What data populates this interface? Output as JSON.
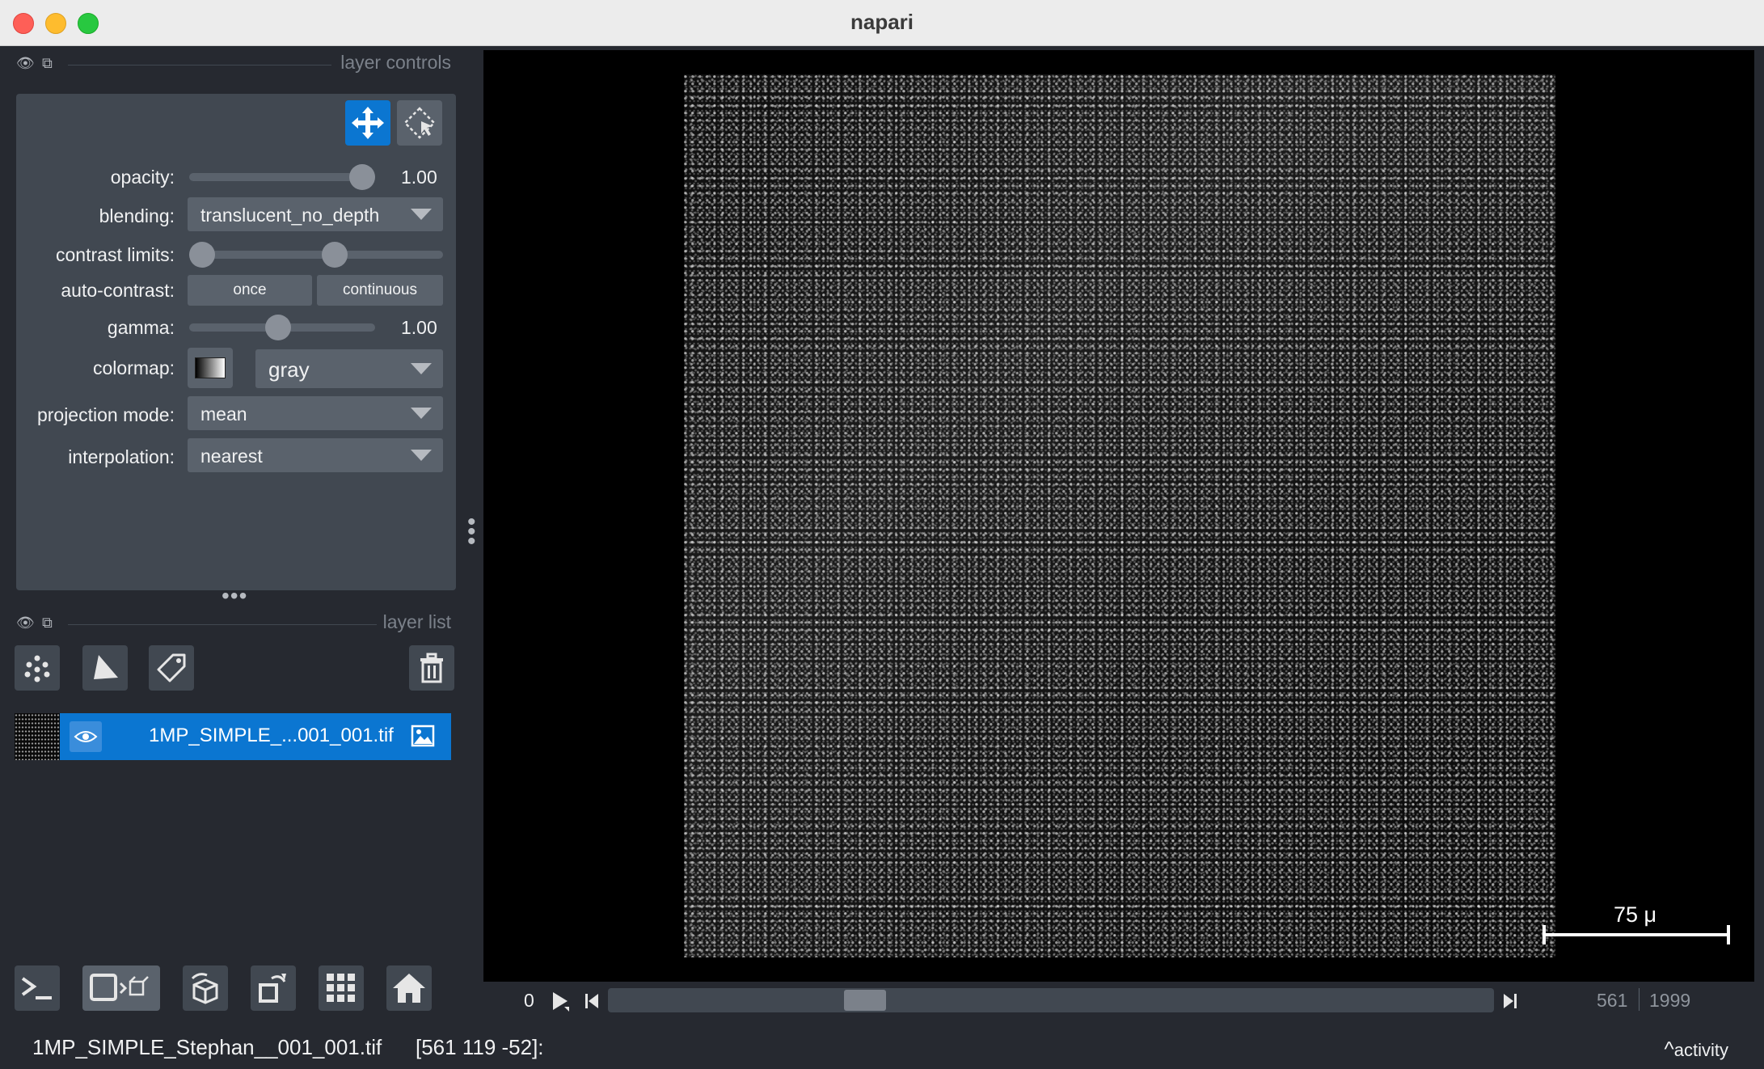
{
  "window": {
    "title": "napari"
  },
  "layer_controls": {
    "dock_label": "layer controls",
    "opacity_label": "opacity:",
    "opacity_value": "1.00",
    "opacity": 1.0,
    "blending_label": "blending:",
    "blending_value": "translucent_no_depth",
    "contrast_label": "contrast limits:",
    "contrast_limits_fraction": [
      0.0,
      0.58
    ],
    "autocontrast_label": "auto-contrast:",
    "once_label": "once",
    "continuous_label": "continuous",
    "gamma_label": "gamma:",
    "gamma_value": "1.00",
    "colormap_label": "colormap:",
    "colormap_value": "gray",
    "projection_label": "projection mode:",
    "projection_value": "mean",
    "interpolation_label": "interpolation:",
    "interpolation_value": "nearest"
  },
  "layer_list": {
    "dock_label": "layer list",
    "layers": [
      {
        "name": "1MP_SIMPLE_...001_001.tif",
        "visible": true,
        "type_icon": "image-icon"
      }
    ]
  },
  "viewer": {
    "scale_bar_label": "75 μ"
  },
  "dims": {
    "start_label": "0",
    "current": "561",
    "max": "1999",
    "position_fraction": 0.28
  },
  "status": {
    "layer_name": "1MP_SIMPLE_Stephan__001_001.tif",
    "coords": "[561 119 -52]:",
    "activity_label": "activity"
  },
  "colors": {
    "background": "#262930",
    "panel": "#414851",
    "accent": "#0b76d1"
  }
}
